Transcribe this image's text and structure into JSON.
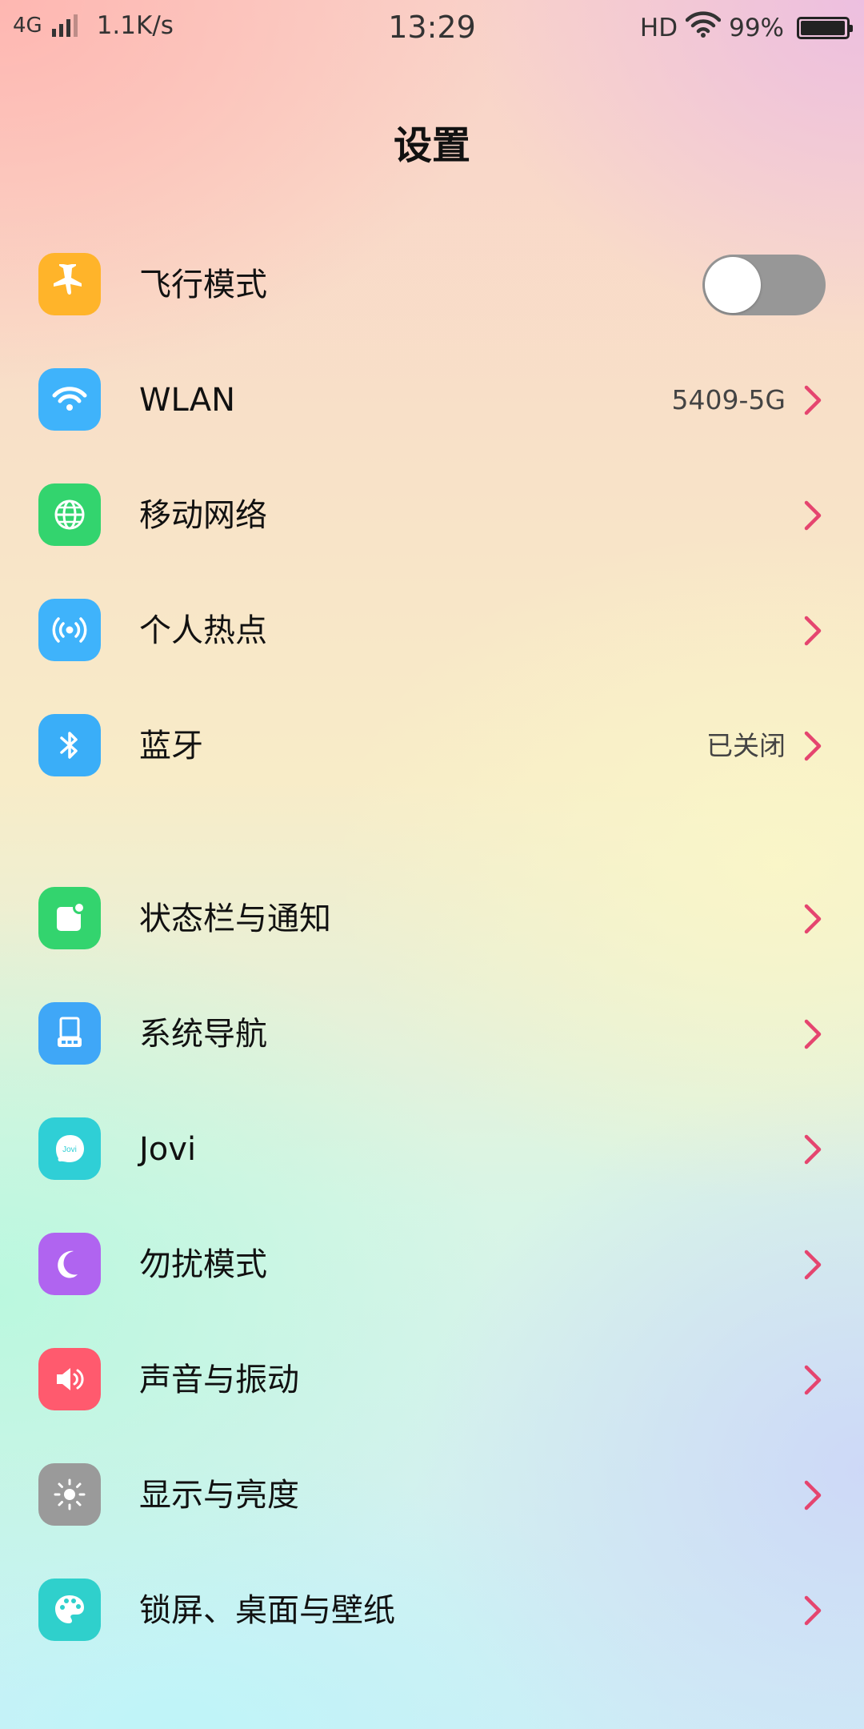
{
  "status_bar": {
    "network": "4G",
    "speed": "1.1K/s",
    "time": "13:29",
    "hd": "HD",
    "battery": "99%",
    "battery_level": 0.99
  },
  "header": {
    "title": "设置"
  },
  "colors": {
    "chevron": "#e5456f",
    "airplane": "#ffb42a",
    "wlan": "#3fb3fb",
    "mobile": "#33d46e",
    "hotspot": "#3fb3fb",
    "bluetooth": "#3aaef8",
    "statusbar": "#33d46e",
    "navigation": "#3fa7f7",
    "jovi": "#2fcfd6",
    "dnd": "#b064f0",
    "sound": "#ff5a6e",
    "display": "#9a9a9a",
    "wallpaper": "#2fd0cc"
  },
  "settings": [
    {
      "label": "飞行模式",
      "icon": "airplane-icon",
      "toggle": true,
      "toggle_on": false
    },
    {
      "label": "WLAN",
      "icon": "wifi-icon",
      "value": "5409-5G"
    },
    {
      "label": "移动网络",
      "icon": "globe-icon"
    },
    {
      "label": "个人热点",
      "icon": "hotspot-icon"
    },
    {
      "label": "蓝牙",
      "icon": "bluetooth-icon",
      "value": "已关闭"
    },
    {
      "label": "状态栏与通知",
      "icon": "notification-icon"
    },
    {
      "label": "系统导航",
      "icon": "navigation-icon"
    },
    {
      "label": "Jovi",
      "icon": "jovi-icon",
      "icon_text": "Jovi"
    },
    {
      "label": "勿扰模式",
      "icon": "moon-icon"
    },
    {
      "label": "声音与振动",
      "icon": "speaker-icon"
    },
    {
      "label": "显示与亮度",
      "icon": "brightness-icon"
    },
    {
      "label": "锁屏、桌面与壁纸",
      "icon": "palette-icon"
    }
  ]
}
